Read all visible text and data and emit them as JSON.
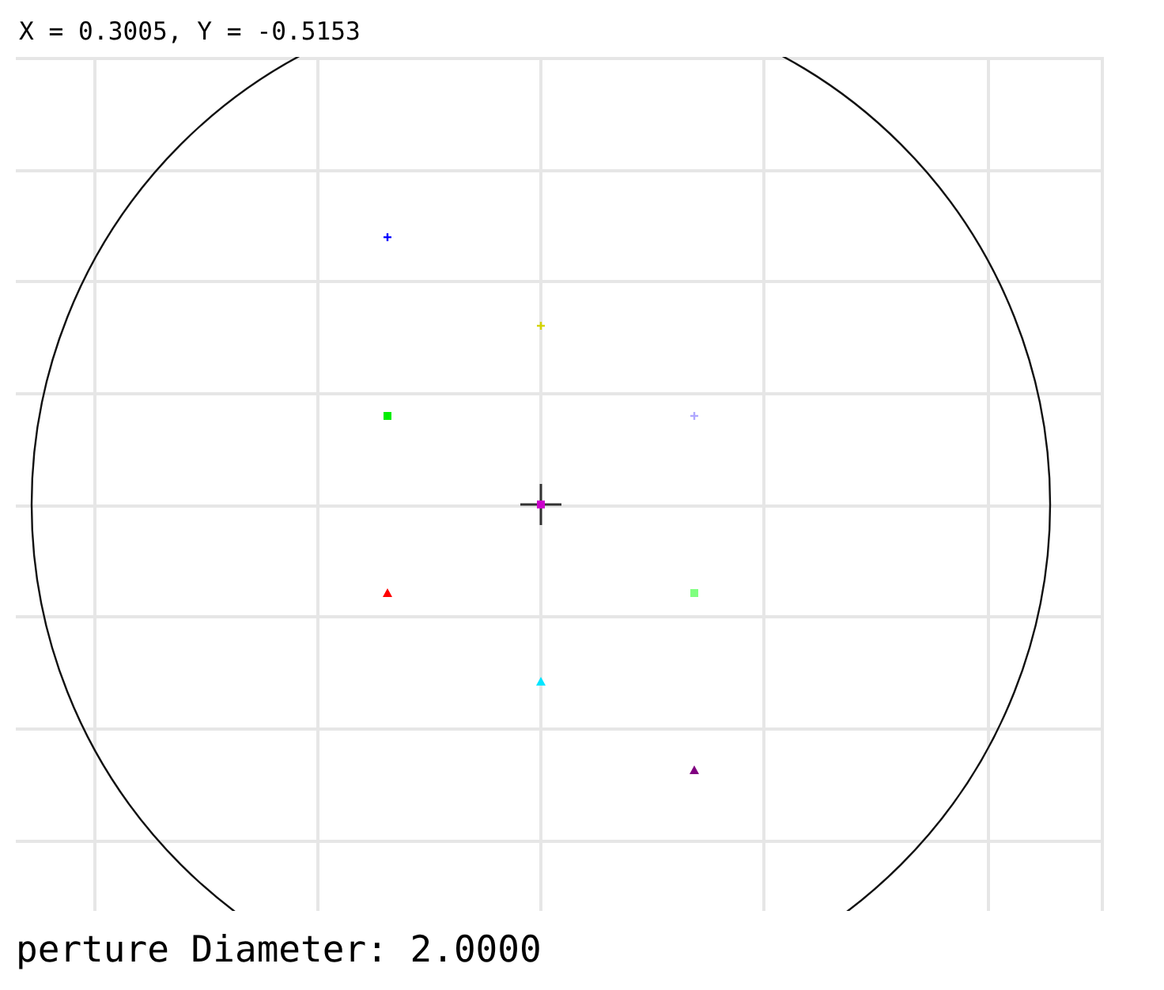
{
  "cursor_readout": "X = 0.3005, Y = -0.5153",
  "points": [
    {
      "kind": "plus",
      "color": "#0000ff"
    },
    {
      "kind": "plus",
      "color": "#d4d400"
    },
    {
      "kind": "square",
      "color": "#00ee00"
    },
    {
      "kind": "plus",
      "color": "#b0a8ff"
    },
    {
      "kind": "square",
      "color": "#cc00cc"
    },
    {
      "kind": "triangle",
      "color": "#ff0000"
    },
    {
      "kind": "square",
      "color": "#80ff80"
    },
    {
      "kind": "triangle",
      "color": "#00e5ff"
    },
    {
      "kind": "triangle",
      "color": "#800080"
    }
  ],
  "footer": "perture Diameter: 2.0000"
}
